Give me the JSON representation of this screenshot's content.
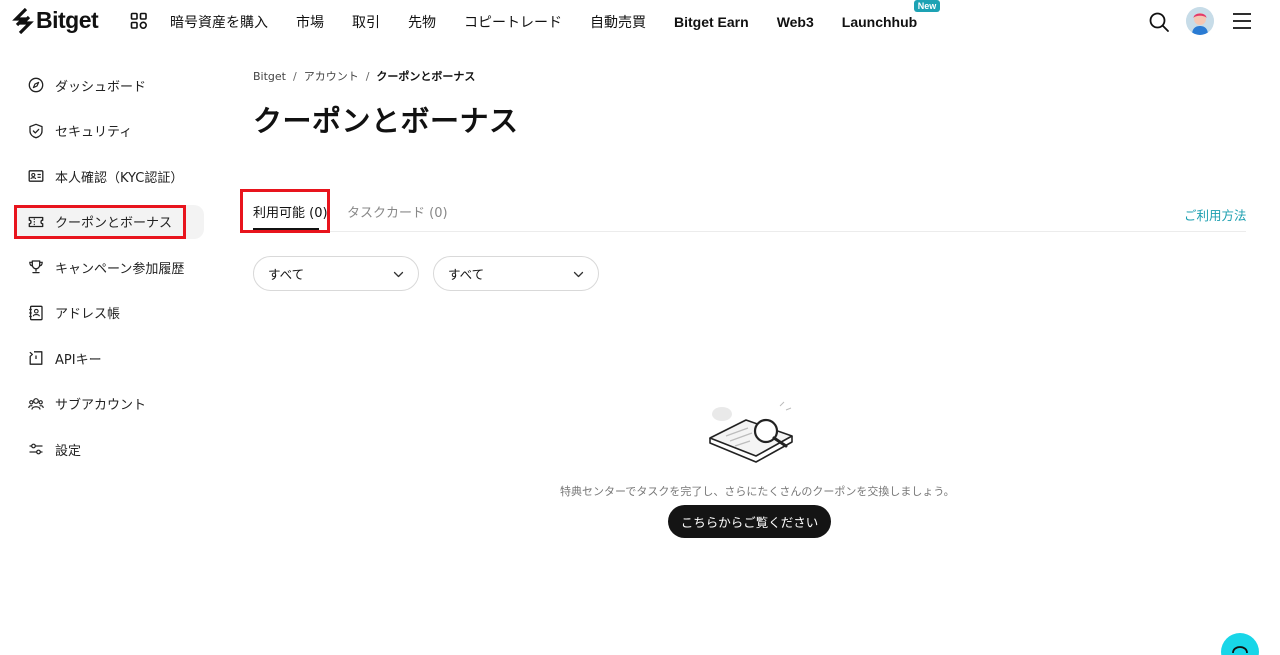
{
  "header": {
    "brand": "Bitget",
    "nav": [
      {
        "label": "暗号資産を購入",
        "latin": false
      },
      {
        "label": "市場",
        "latin": false
      },
      {
        "label": "取引",
        "latin": false
      },
      {
        "label": "先物",
        "latin": false
      },
      {
        "label": "コピートレード",
        "latin": false
      },
      {
        "label": "自動売買",
        "latin": false
      },
      {
        "label": "Bitget Earn",
        "latin": true
      },
      {
        "label": "Web3",
        "latin": true
      },
      {
        "label": "Launchhub",
        "latin": true
      }
    ],
    "new_badge": "New"
  },
  "sidebar": {
    "items": [
      {
        "label": "ダッシュボード",
        "icon": "compass-icon"
      },
      {
        "label": "セキュリティ",
        "icon": "shield-check-icon"
      },
      {
        "label": "本人確認（KYC認証）",
        "icon": "id-card-icon"
      },
      {
        "label": "クーポンとボーナス",
        "icon": "ticket-icon",
        "active": true
      },
      {
        "label": "キャンペーン参加履歴",
        "icon": "trophy-icon"
      },
      {
        "label": "アドレス帳",
        "icon": "address-book-icon"
      },
      {
        "label": "APIキー",
        "icon": "api-key-icon"
      },
      {
        "label": "サブアカウント",
        "icon": "users-icon"
      },
      {
        "label": "設定",
        "icon": "sliders-icon"
      }
    ]
  },
  "breadcrumb": {
    "items": [
      "Bitget",
      "アカウント",
      "クーポンとボーナス"
    ],
    "separator": "/"
  },
  "page": {
    "title": "クーポンとボーナス"
  },
  "tabs": [
    {
      "label": "利用可能 (0)",
      "active": true
    },
    {
      "label": "タスクカード (0)",
      "active": false
    }
  ],
  "help_link": "ご利用方法",
  "filters": [
    {
      "value": "すべて"
    },
    {
      "value": "すべて"
    }
  ],
  "empty": {
    "message": "特典センターでタスクを完了し、さらにたくさんのクーポンを交換しましょう。",
    "cta": "こちらからご覧ください"
  },
  "colors": {
    "accent": "#1c9fb0",
    "highlight": "#e8141d",
    "primary_button": "#141414",
    "support_button": "#18d6e8"
  }
}
